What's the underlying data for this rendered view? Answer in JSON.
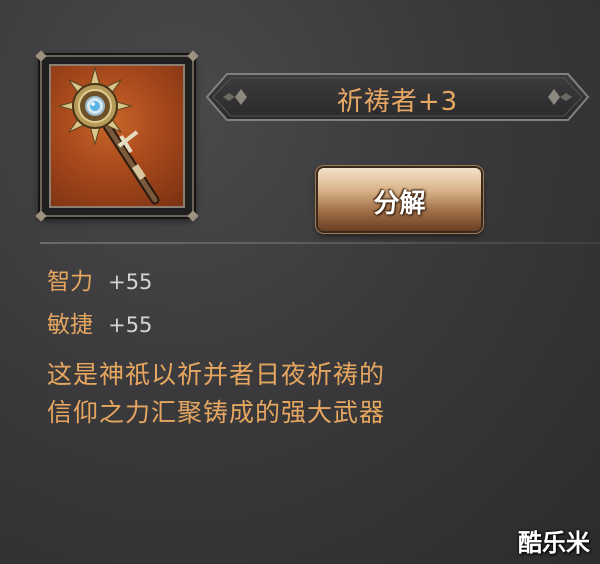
{
  "item": {
    "name": "祈祷者+3",
    "icon": "holy-mace-icon",
    "frame_color": "#a8491c"
  },
  "actions": {
    "decompose_label": "分解"
  },
  "stats": [
    {
      "name": "智力",
      "value": "+55"
    },
    {
      "name": "敏捷",
      "value": "+55"
    }
  ],
  "description": {
    "line1": "这是神祇以祈并者日夜祈祷的",
    "line2": "信仰之力汇聚铸成的强大武器"
  },
  "watermark": "酷乐米",
  "colors": {
    "accent_text": "#e6a660",
    "value_text": "#d5d5d5",
    "button_gradient_top": "#f3e2c9",
    "button_gradient_bottom": "#6a3f24"
  }
}
